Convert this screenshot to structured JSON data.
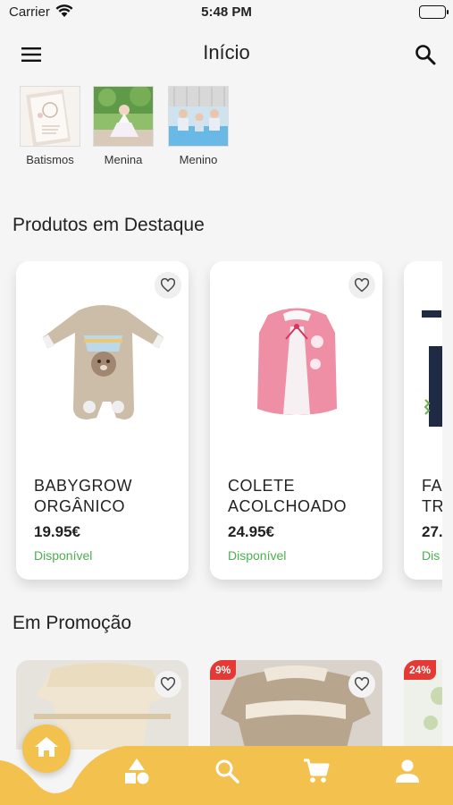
{
  "status_bar": {
    "carrier": "Carrier",
    "time": "5:48 PM"
  },
  "header": {
    "title": "Início"
  },
  "categories": [
    {
      "label": "Batismos"
    },
    {
      "label": "Menina"
    },
    {
      "label": "Menino"
    }
  ],
  "featured": {
    "title": "Produtos em Destaque",
    "products": [
      {
        "name": "BABYGROW\nORGÂNICO",
        "price": "19.95€",
        "availability": "Disponível"
      },
      {
        "name": "COLETE\nACOLCHOADO",
        "price": "24.95€",
        "availability": "Disponível"
      },
      {
        "name": "FA\nTR",
        "price": "27.",
        "availability": "Dis"
      }
    ]
  },
  "promotions": {
    "title": "Em Promoção",
    "items": [
      {
        "badge": ""
      },
      {
        "badge": "9%"
      },
      {
        "badge": "24%"
      }
    ]
  },
  "theme": {
    "accent": "#f2c14e",
    "available_green": "#4caf50",
    "badge_red": "#e53935"
  },
  "nav": {
    "items": [
      "home-icon",
      "categories-icon",
      "search-icon",
      "cart-icon",
      "profile-icon"
    ]
  }
}
